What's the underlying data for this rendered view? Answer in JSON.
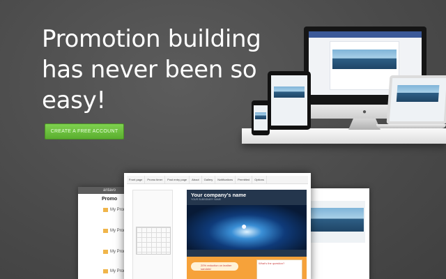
{
  "hero": {
    "title": "Promotion building has never been so easy!",
    "cta_label": "CREATE A FREE ACCOUNT"
  },
  "editor": {
    "tabs": [
      "Front page",
      "Promo timer",
      "Post entry page",
      "About",
      "Gallery",
      "Notifications",
      "Permitted",
      "Options"
    ],
    "company_title": "Your company's name",
    "company_subtitle": "YOUR SUBSIDIARY NAME",
    "promo_text": "20% reduction on leather sandals!",
    "question_text": "What's the question?"
  },
  "left_panel": {
    "brand": "antavo",
    "title": "Promo",
    "items": [
      "My Prom",
      "My Prom",
      "My Prom",
      "My Prom"
    ]
  },
  "colors": {
    "background": "#4a4a4a",
    "cta": "#6cc53c",
    "facebook": "#3b5998",
    "promo_orange": "#f6a23a"
  }
}
